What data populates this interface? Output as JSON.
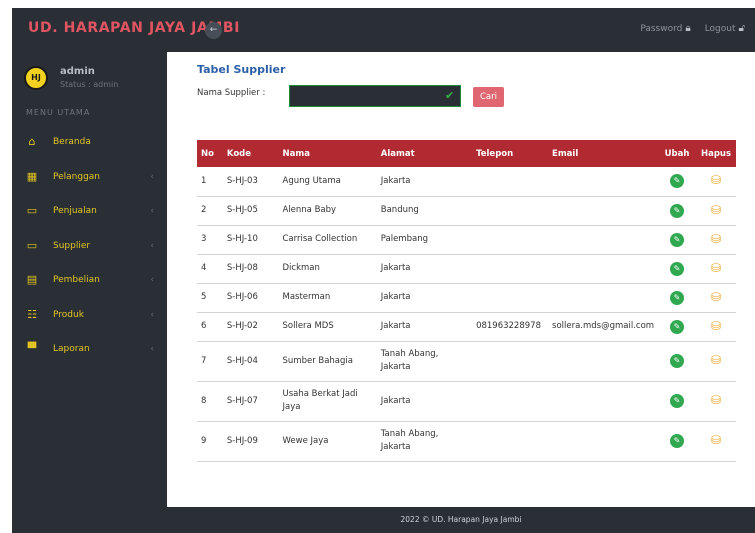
{
  "header": {
    "brand": "UD. HARAPAN JAYA JAMBI",
    "toggle_icon": "←",
    "password_label": "Password",
    "logout_label": "Logout"
  },
  "sidebar": {
    "avatar_text": "HJ",
    "username": "admin",
    "status": "Status : admin",
    "menu_heading": "MENU UTAMA",
    "items": [
      {
        "label": "Beranda",
        "icon": "⌂",
        "chevron": ""
      },
      {
        "label": "Pelanggan",
        "icon": "▦",
        "chevron": "‹"
      },
      {
        "label": "Penjualan",
        "icon": "▭",
        "chevron": "‹"
      },
      {
        "label": "Supplier",
        "icon": "▭",
        "chevron": "‹"
      },
      {
        "label": "Pembelian",
        "icon": "▤",
        "chevron": "‹"
      },
      {
        "label": "Produk",
        "icon": "☷",
        "chevron": "‹"
      },
      {
        "label": "Laporan",
        "icon": "▀",
        "chevron": "‹"
      }
    ]
  },
  "main": {
    "title": "Tabel Supplier",
    "search": {
      "label": "Nama Supplier :",
      "value": "",
      "placeholder": "",
      "button": "Cari"
    },
    "table": {
      "headers": [
        "No",
        "Kode",
        "Nama",
        "Alamat",
        "Telepon",
        "Email",
        "Ubah",
        "Hapus"
      ],
      "rows": [
        {
          "no": "1",
          "kode": "S-HJ-03",
          "nama": "Agung Utama",
          "alamat": "Jakarta",
          "telepon": "",
          "email": ""
        },
        {
          "no": "2",
          "kode": "S-HJ-05",
          "nama": "Alenna Baby",
          "alamat": "Bandung",
          "telepon": "",
          "email": ""
        },
        {
          "no": "3",
          "kode": "S-HJ-10",
          "nama": "Carrisa Collection",
          "alamat": "Palembang",
          "telepon": "",
          "email": ""
        },
        {
          "no": "4",
          "kode": "S-HJ-08",
          "nama": "Dickman",
          "alamat": "Jakarta",
          "telepon": "",
          "email": ""
        },
        {
          "no": "5",
          "kode": "S-HJ-06",
          "nama": "Masterman",
          "alamat": "Jakarta",
          "telepon": "",
          "email": ""
        },
        {
          "no": "6",
          "kode": "S-HJ-02",
          "nama": "Sollera MDS",
          "alamat": "Jakarta",
          "telepon": "081963228978",
          "email": "sollera.mds@gmail.com"
        },
        {
          "no": "7",
          "kode": "S-HJ-04",
          "nama": "Sumber Bahagia",
          "alamat": "Tanah Abang, Jakarta",
          "telepon": "",
          "email": ""
        },
        {
          "no": "8",
          "kode": "S-HJ-07",
          "nama": "Usaha Berkat Jadi Jaya",
          "alamat": "Jakarta",
          "telepon": "",
          "email": ""
        },
        {
          "no": "9",
          "kode": "S-HJ-09",
          "nama": "Wewe Jaya",
          "alamat": "Tanah Abang, Jakarta",
          "telepon": "",
          "email": ""
        }
      ]
    }
  },
  "footer": {
    "text": "2022 © UD. Harapan Jaya Jambi"
  },
  "colors": {
    "topbar_bg": "#2a2f35",
    "brand_red": "#e05561",
    "menu_yellow": "#e3c522",
    "table_header": "#b12a32",
    "title_blue": "#2d5fa8",
    "edit_green": "#2fa84f",
    "delete_orange": "#e6a526",
    "search_button": "#e06672"
  }
}
